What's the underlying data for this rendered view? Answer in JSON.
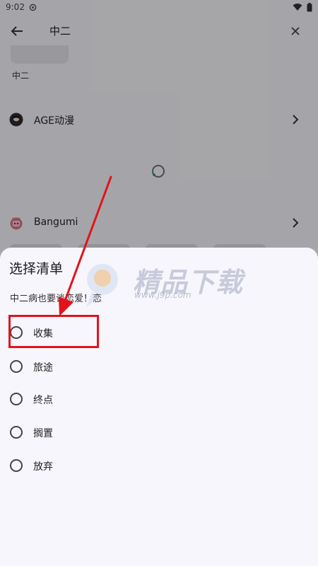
{
  "status_bar": {
    "time": "9:02"
  },
  "app_bar": {
    "search_value": "中二"
  },
  "results": {
    "first_result_name": "中二",
    "sources": [
      {
        "label": "AGE动漫",
        "icon": "age-anime-logo-icon"
      },
      {
        "label": "Bangumi",
        "icon": "bangumi-logo-icon"
      }
    ]
  },
  "sheet": {
    "title": "选择清单",
    "subtitle": "中二病也要谈恋爱！恋",
    "options": [
      {
        "label": "收集",
        "selected": false
      },
      {
        "label": "旅途",
        "selected": false
      },
      {
        "label": "终点",
        "selected": false
      },
      {
        "label": "搁置",
        "selected": false
      },
      {
        "label": "放弃",
        "selected": false
      }
    ]
  },
  "watermark": {
    "title": "精品下载",
    "url": "www.j9p.com"
  },
  "colors": {
    "annotation_red": "#e1141b",
    "scrim": "rgba(0,0,0,0.32)",
    "sheet_bg": "#f7f6fc"
  }
}
